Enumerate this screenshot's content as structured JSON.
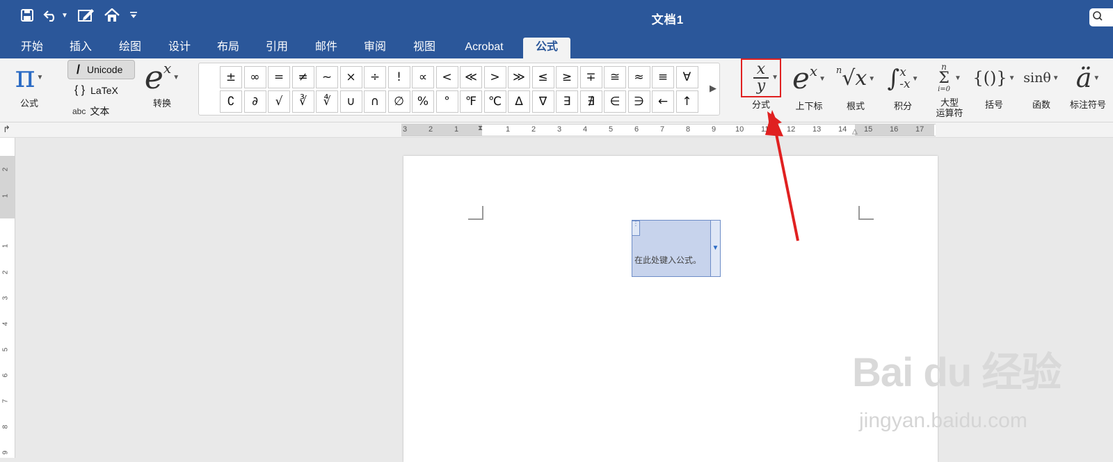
{
  "window": {
    "title": "文档1"
  },
  "quick_access": {
    "icons": [
      "save-icon",
      "undo-icon",
      "undo-dropdown-icon",
      "edit-document-icon",
      "home-icon",
      "customize-icon"
    ]
  },
  "tabs": [
    {
      "label": "开始"
    },
    {
      "label": "插入"
    },
    {
      "label": "绘图"
    },
    {
      "label": "设计"
    },
    {
      "label": "布局"
    },
    {
      "label": "引用"
    },
    {
      "label": "邮件"
    },
    {
      "label": "审阅"
    },
    {
      "label": "视图"
    },
    {
      "label": "Acrobat"
    },
    {
      "label": "公式",
      "active": true
    }
  ],
  "ribbon": {
    "equation_label": "公式",
    "modes": {
      "unicode": "Unicode",
      "latex": "LaTeX",
      "text_prefix": "abc",
      "text": "文本"
    },
    "convert_label": "转换",
    "symbols_row1": [
      "±",
      "∞",
      "=",
      "≠",
      "~",
      "×",
      "÷",
      "!",
      "∝",
      "<",
      "≪",
      ">",
      "≫",
      "≤",
      "≥",
      "∓",
      "≅",
      "≈",
      "≡",
      "∀"
    ],
    "symbols_row2": [
      "∁",
      "∂",
      "√",
      "∛",
      "∜",
      "∪",
      "∩",
      "∅",
      "%",
      "°",
      "℉",
      "℃",
      "∆",
      "∇",
      "∃",
      "∄",
      "∈",
      "∋",
      "←",
      "↑"
    ],
    "structures": [
      {
        "label": "分式"
      },
      {
        "label": "上下标"
      },
      {
        "label": "根式"
      },
      {
        "label": "积分"
      },
      {
        "label": "大型\n运算符"
      },
      {
        "label": "括号"
      },
      {
        "label": "函数"
      },
      {
        "label": "标注符号"
      }
    ],
    "glyphs": {
      "fraction_num": "x",
      "fraction_den": "y",
      "script": "e",
      "script_sup": "x",
      "radical_index": "n",
      "radical_body": "√x",
      "integral": "∫",
      "integral_upper": "x",
      "integral_lower": "-x",
      "large_op_upper": "n",
      "large_op": "Σ",
      "large_op_lower": "i=0",
      "bracket": "{()}",
      "function": "sinθ",
      "accent": "ä",
      "pi": "π",
      "convert": "e",
      "convert_sup": "x"
    }
  },
  "ruler": {
    "left_marks": [
      "3",
      "2",
      "1"
    ],
    "marks": [
      "1",
      "2",
      "3",
      "4",
      "5",
      "6",
      "7",
      "8",
      "9",
      "10",
      "11",
      "12",
      "13",
      "14",
      "15",
      "16",
      "17"
    ],
    "vertical_marks": [
      "2",
      "1",
      "1",
      "2",
      "3",
      "4",
      "5",
      "6",
      "7",
      "8",
      "9"
    ]
  },
  "document": {
    "equation_placeholder": "在此处键入公式。"
  },
  "watermark": {
    "logo": "Bai du 经验",
    "url": "jingyan.baidu.com"
  },
  "colors": {
    "ribbon_blue": "#2b579a",
    "highlight_red": "#e02020",
    "equation_bg": "#c7d3ec"
  }
}
